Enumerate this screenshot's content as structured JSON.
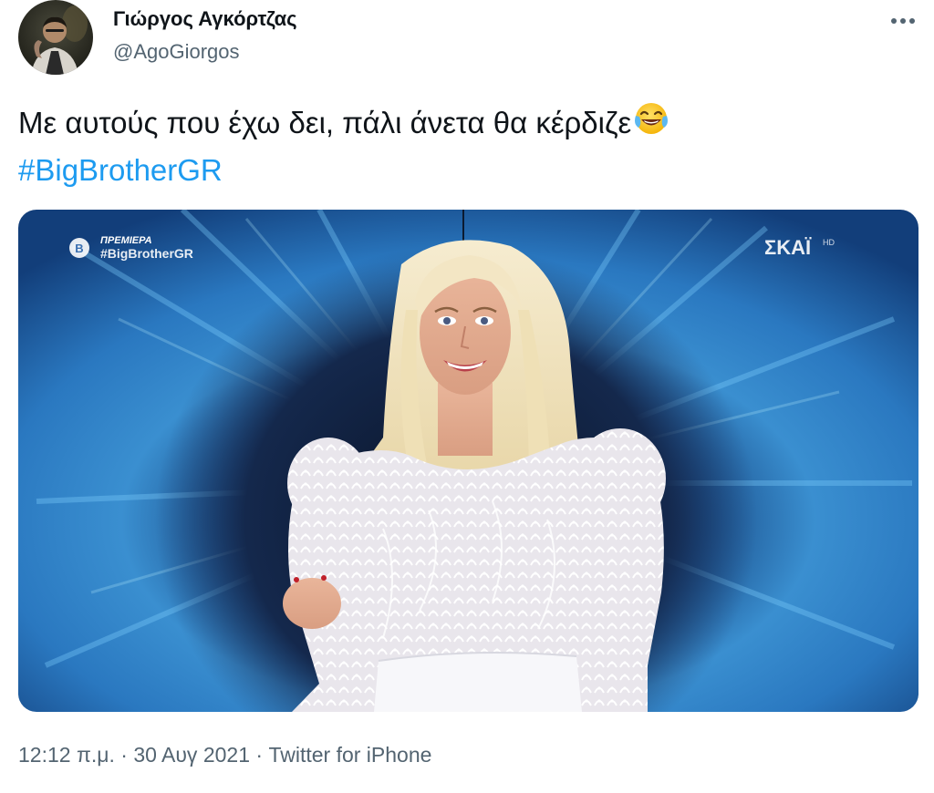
{
  "author": {
    "display_name": "Γιώργος Αγκόρτζας",
    "handle": "@AgoGiorgos"
  },
  "tweet": {
    "text_part": "Με αυτούς που έχω δει, πάλι άνετα θα κέρδιζε",
    "emoji": "face-with-tears-of-joy",
    "hashtag": "#BigBrotherGR"
  },
  "media": {
    "overlay_premiere": "ΠΡΕΜΙΕΡΑ",
    "overlay_hashtag": "#BigBrotherGR",
    "channel_logo": "ΣΚΑΪ",
    "channel_hd": "HD",
    "overlay_badge_letter": "B"
  },
  "meta": {
    "time": "12:12 π.μ.",
    "separator": "·",
    "date": "30 Αυγ 2021",
    "source": "Twitter for iPhone"
  },
  "colors": {
    "text": "#0f1419",
    "secondary": "#536471",
    "link": "#1d9bf0"
  }
}
